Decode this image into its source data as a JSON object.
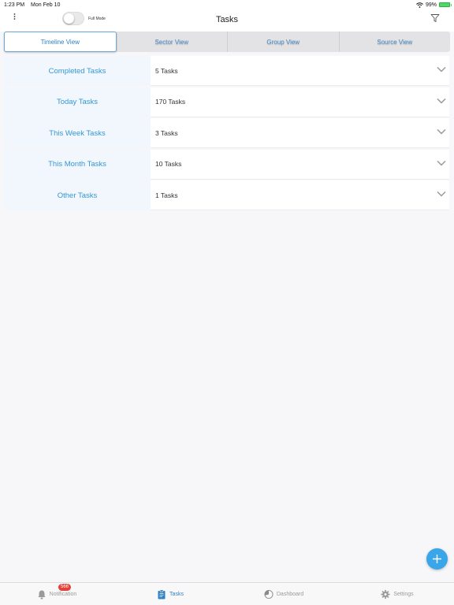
{
  "status_bar": {
    "time": "1:23 PM",
    "date": "Mon Feb 10",
    "battery": "99%"
  },
  "nav": {
    "title": "Tasks",
    "toggle_label": "Full Mode"
  },
  "segments": [
    {
      "label": "Timeline View",
      "active": true
    },
    {
      "label": "Sector View",
      "active": false
    },
    {
      "label": "Group View",
      "active": false
    },
    {
      "label": "Source View",
      "active": false
    }
  ],
  "tasks": [
    {
      "label": "Completed Tasks",
      "count": "5 Tasks"
    },
    {
      "label": "Today Tasks",
      "count": "170 Tasks"
    },
    {
      "label": "This Week Tasks",
      "count": "3 Tasks"
    },
    {
      "label": "This Month Tasks",
      "count": "10 Tasks"
    },
    {
      "label": "Other Tasks",
      "count": "1 Tasks"
    }
  ],
  "tab_bar": {
    "notification_label": "Notification",
    "notification_badge": "566",
    "tasks_label": "Tasks",
    "dashboard_label": "Dashboard",
    "settings_label": "Settings"
  },
  "colors": {
    "accent": "#3397d6",
    "fab": "#3aa6ea",
    "badge": "#e5403a"
  }
}
